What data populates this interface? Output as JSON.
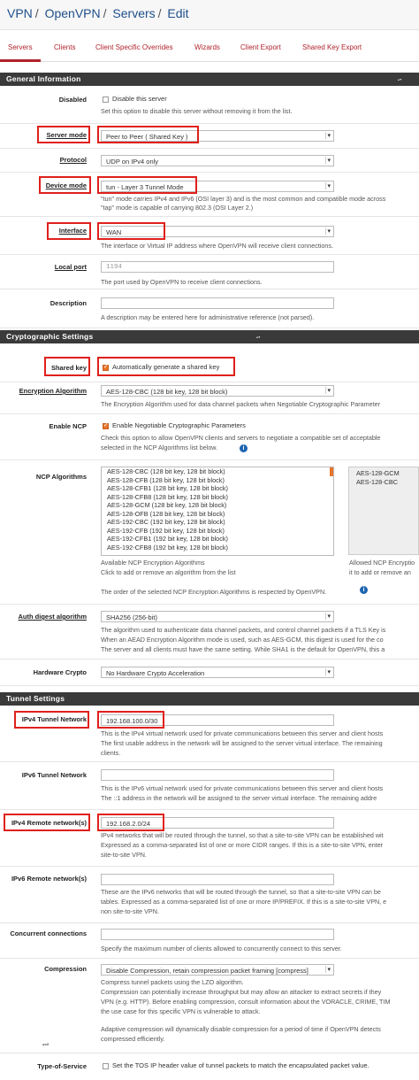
{
  "breadcrumb": [
    "VPN",
    "OpenVPN",
    "Servers",
    "Edit"
  ],
  "tabs": [
    "Servers",
    "Clients",
    "Client Specific Overrides",
    "Wizards",
    "Client Export",
    "Shared Key Export"
  ],
  "sections": {
    "general": "General Information",
    "crypto": "Cryptographic Settings",
    "tunnel": "Tunnel Settings"
  },
  "general": {
    "disabled": {
      "label": "Disabled",
      "checkbox": "Disable this server",
      "help": "Set this option to disable this server without removing it from the list."
    },
    "server_mode": {
      "label": "Server mode",
      "value": "Peer to Peer ( Shared Key )"
    },
    "protocol": {
      "label": "Protocol",
      "value": "UDP on IPv4 only"
    },
    "device_mode": {
      "label": "Device mode",
      "value": "tun - Layer 3 Tunnel Mode",
      "help1": "\"tun\" mode carries IPv4 and IPv6 (OSI layer 3) and is the most common and compatible mode across",
      "help2": "\"tap\" mode is capable of carrying 802.3 (OSI Layer 2.)"
    },
    "interface": {
      "label": "Interface",
      "value": "WAN",
      "help": "The interface or Virtual IP address where OpenVPN will receive client connections."
    },
    "local_port": {
      "label": "Local port",
      "placeholder": "1194",
      "help": "The port used by OpenVPN to receive client connections."
    },
    "description": {
      "label": "Description",
      "help": "A description may be entered here for administrative reference (not parsed)."
    }
  },
  "crypto": {
    "shared_key": {
      "label": "Shared key",
      "checkbox": "Automatically generate a shared key"
    },
    "encryption": {
      "label": "Encryption Algorithm",
      "value": "AES-128-CBC (128 bit key, 128 bit block)",
      "help": "The Encryption Algorithm used for data channel packets when Negotiable Cryptographic Parameter"
    },
    "ncp": {
      "label": "Enable NCP",
      "checkbox": "Enable Negotiable Cryptographic Parameters",
      "help1": "Check this option to allow OpenVPN clients and servers to negotiate a compatible set of acceptable",
      "help2": "selected in the NCP Algorithms list below."
    },
    "ncp_algorithms": {
      "label": "NCP Algorithms",
      "available": [
        "AES-128-CBC (128 bit key, 128 bit block)",
        "AES-128-CFB (128 bit key, 128 bit block)",
        "AES-128-CFB1 (128 bit key, 128 bit block)",
        "AES-128-CFB8 (128 bit key, 128 bit block)",
        "AES-128-GCM (128 bit key, 128 bit block)",
        "AES-128-OFB (128 bit key, 128 bit block)",
        "AES-192-CBC (192 bit key, 128 bit block)",
        "AES-192-CFB (192 bit key, 128 bit block)",
        "AES-192-CFB1 (192 bit key, 128 bit block)",
        "AES-192-CFB8 (192 bit key, 128 bit block)"
      ],
      "allowed": [
        "AES-128-GCM",
        "AES-128-CBC"
      ],
      "available_help1": "Available NCP Encryption Algorithms",
      "available_help2": "Click to add or remove an algorithm from the list",
      "allowed_help1": "Allowed NCP Encryptio",
      "allowed_help2": "it to add or remove an",
      "order_help": "The order of the selected NCP Encryption Algorithms is respected by OpenVPN."
    },
    "auth_digest": {
      "label": "Auth digest algorithm",
      "value": "SHA256 (256-bit)",
      "help1": "The algorithm used to authenticate data channel packets, and control channel packets if a TLS Key is",
      "help2": "When an AEAD Encryption Algorithm mode is used, such as AES-GCM, this digest is used for the co",
      "help3": "The server and all clients must have the same setting. While SHA1 is the default for OpenVPN, this a"
    },
    "hw_crypto": {
      "label": "Hardware Crypto",
      "value": "No Hardware Crypto Acceleration"
    }
  },
  "tunnel": {
    "ipv4_tunnel": {
      "label": "IPv4 Tunnel Network",
      "value": "192.168.100.0/30",
      "help1": "This is the IPv4 virtual network used for private communications between this server and client hosts",
      "help2": "The first usable address in the network will be assigned to the server virtual interface. The remaining",
      "help3": "clients."
    },
    "ipv6_tunnel": {
      "label": "IPv6 Tunnel Network",
      "help1": "This is the IPv6 virtual network used for private communications between this server and client hosts",
      "help2": "The ::1 address in the network will be assigned to the server virtual interface. The remaining addre"
    },
    "ipv4_remote": {
      "label": "IPv4 Remote network(s)",
      "value": "192.168.2.0/24",
      "help1": "IPv4 networks that will be routed through the tunnel, so that a site-to-site VPN can be established wit",
      "help2": "Expressed as a comma-separated list of one or more CIDR ranges. If this is a site-to-site VPN, enter",
      "help3": "site-to-site VPN."
    },
    "ipv6_remote": {
      "label": "IPv6 Remote network(s)",
      "help1": "These are the IPv6 networks that will be routed through the tunnel, so that a site-to-site VPN can be",
      "help2": "tables. Expressed as a comma-separated list of one or more IP/PREFIX. If this is a site-to-site VPN, e",
      "help3": "non site-to-site VPN."
    },
    "concurrent": {
      "label": "Concurrent connections",
      "help": "Specify the maximum number of clients allowed to concurrently connect to this server."
    },
    "compression": {
      "label": "Compression",
      "value": "Disable Compression, retain compression packet framing [compress]",
      "help1": "Compress tunnel packets using the LZO algorithm.",
      "help2": "Compression can potentially increase throughput but may allow an attacker to extract secrets if they",
      "help3": "VPN (e.g. HTTP). Before enabling compression, consult information about the VORACLE, CRIME, TIM",
      "help4": "the use case for this specific VPN is vulnerable to attack.",
      "help5": "Adaptive compression will dynamically disable compression for a period of time if OpenVPN detects",
      "help6": "compressed efficiently."
    },
    "tos": {
      "label": "Type-of-Service",
      "checkbox": "Set the TOS IP header value of tunnel packets to match the encapsulated packet value."
    }
  },
  "colors": {
    "accent": "#b0232c",
    "highlight": "#e0201b",
    "section_bg": "#3a3a3a",
    "checkbox_on": "#e8752b",
    "link": "#1f4f8a"
  },
  "icons": {
    "info": "info-icon"
  }
}
